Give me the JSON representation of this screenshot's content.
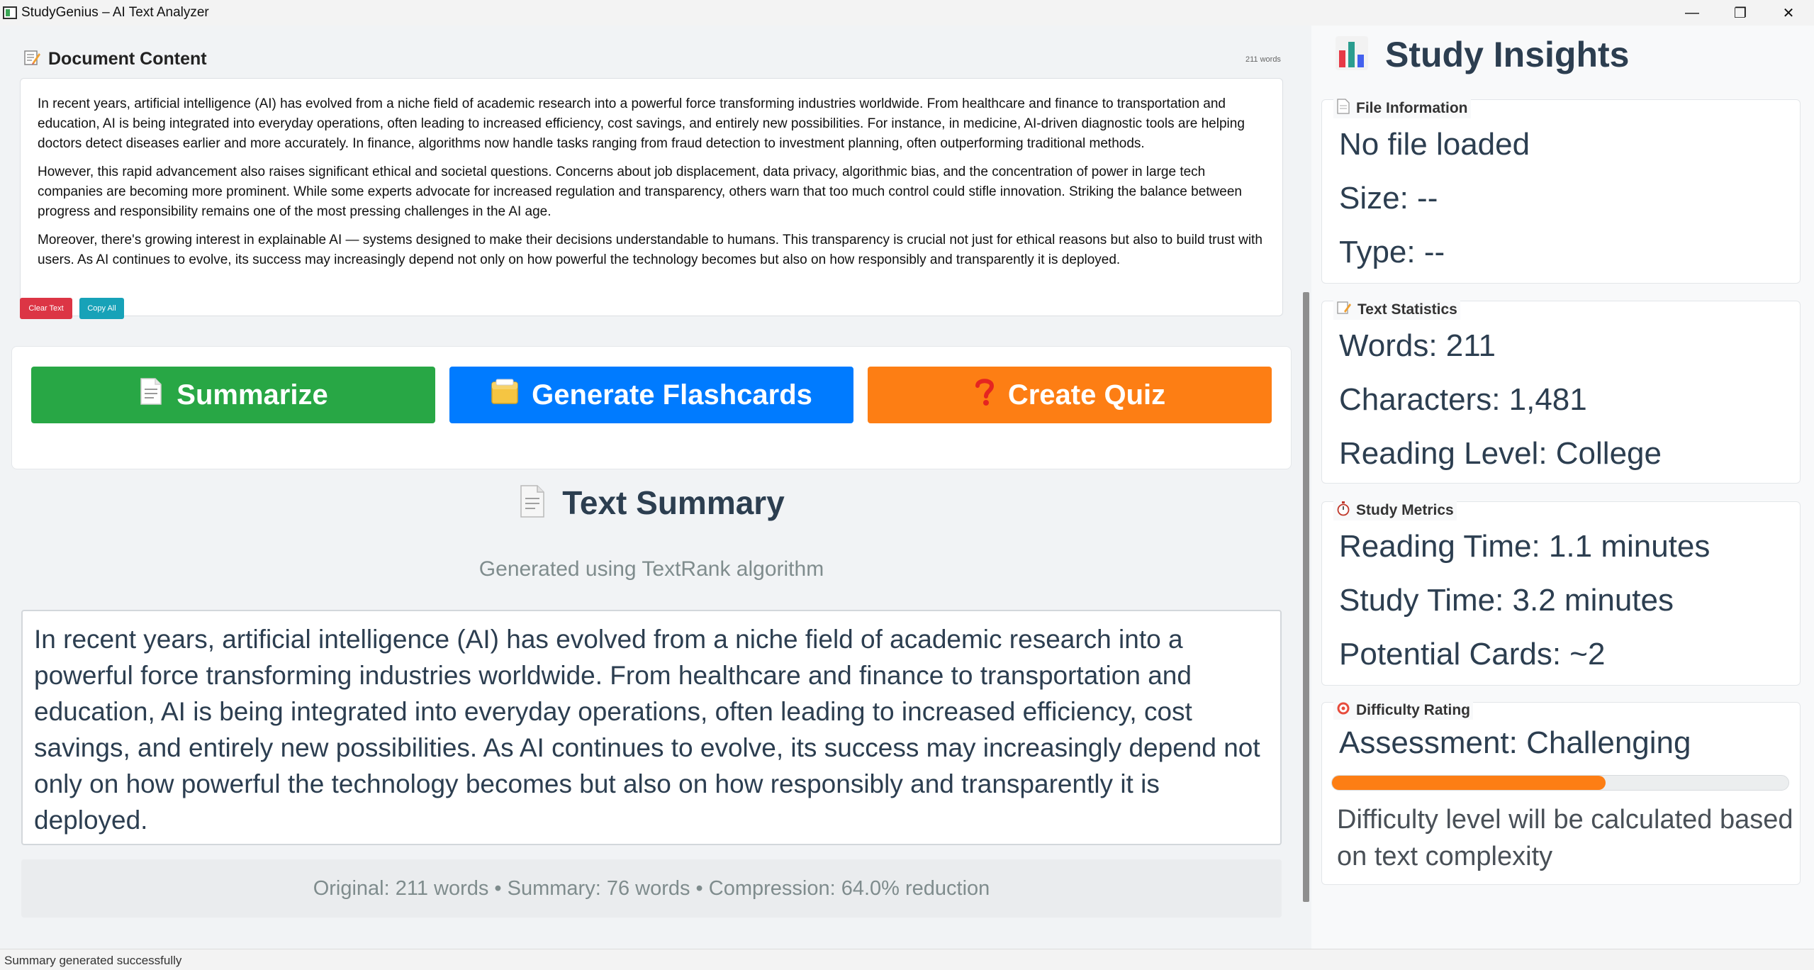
{
  "window": {
    "title": "StudyGenius – AI Text Analyzer",
    "minimize_glyph": "—",
    "restore_glyph": "❐",
    "close_glyph": "✕"
  },
  "document": {
    "title": "Document Content",
    "word_count_label": "211 words",
    "paragraphs": [
      "In recent years, artificial intelligence (AI) has evolved from a niche field of academic research into a powerful force transforming industries worldwide. From healthcare and finance to transportation and education, AI is being integrated into everyday operations, often leading to increased efficiency, cost savings, and entirely new possibilities. For instance, in medicine, AI-driven diagnostic tools are helping doctors detect diseases earlier and more accurately. In finance, algorithms now handle tasks ranging from fraud detection to investment planning, often outperforming traditional methods.",
      "However, this rapid advancement also raises significant ethical and societal questions. Concerns about job displacement, data privacy, algorithmic bias, and the concentration of power in large tech companies are becoming more prominent. While some experts advocate for increased regulation and transparency, others warn that too much control could stifle innovation. Striking the balance between progress and responsibility remains one of the most pressing challenges in the AI age.",
      "Moreover, there's growing interest in explainable AI — systems designed to make their decisions understandable to humans. This transparency is crucial not just for ethical reasons but also to build trust with users. As AI continues to evolve, its success may increasingly depend not only on how powerful the technology becomes but also on how responsibly and transparently it is deployed."
    ],
    "clear_label": "Clear Text",
    "copy_label": "Copy All"
  },
  "actions": {
    "summarize_label": "Summarize",
    "flashcards_label": "Generate Flashcards",
    "quiz_label": "Create Quiz",
    "colors": {
      "summarize": "#28a745",
      "flashcards": "#007bff",
      "quiz": "#fd7e14",
      "clear": "#dc3545",
      "copy": "#17a2b8"
    }
  },
  "summary": {
    "title": "Text Summary",
    "subtitle": "Generated using TextRank algorithm",
    "text": "In recent years, artificial intelligence (AI) has evolved from a niche field of academic research into a powerful force transforming industries worldwide. From healthcare and finance to transportation and education, AI is being integrated into everyday operations, often leading to increased efficiency, cost savings, and entirely new possibilities. As AI continues to evolve, its success may increasingly depend not only on how powerful the technology becomes but also on how responsibly and transparently it is deployed.",
    "stats": "Original: 211 words • Summary: 76 words • Compression: 64.0% reduction"
  },
  "insights": {
    "title": "Study Insights",
    "file_info": {
      "title": "File Information",
      "file": "No file loaded",
      "size": "Size: --",
      "type": "Type: --"
    },
    "text_stats": {
      "title": "Text Statistics",
      "words": "Words: 211",
      "characters": "Characters: 1,481",
      "reading_level": "Reading Level: College"
    },
    "study_metrics": {
      "title": "Study Metrics",
      "reading_time": "Reading Time: 1.1 minutes",
      "study_time": "Study Time: 3.2 minutes",
      "potential_cards": "Potential Cards: ~2"
    },
    "difficulty": {
      "title": "Difficulty Rating",
      "assessment": "Assessment: Challenging",
      "progress_percent": 60,
      "note": "Difficulty level will be calculated based on text complexity"
    }
  },
  "status": {
    "message": "Summary generated successfully"
  }
}
